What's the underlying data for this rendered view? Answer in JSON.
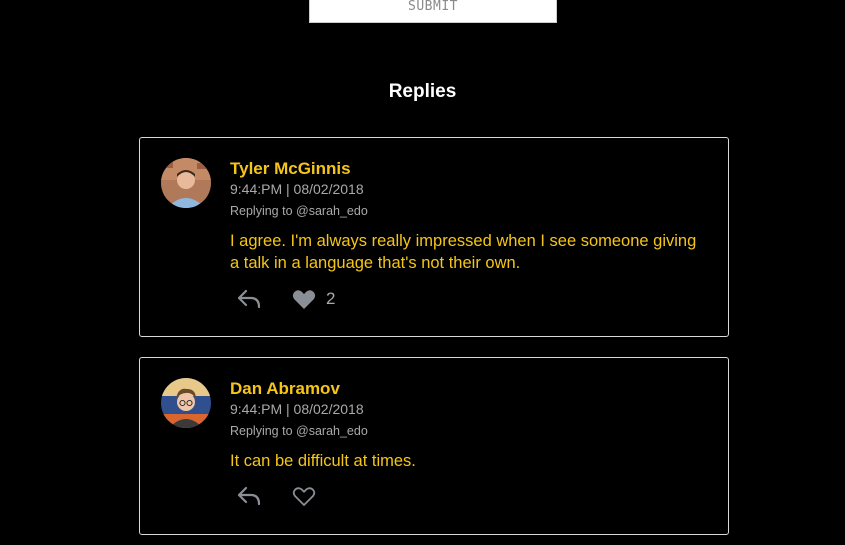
{
  "form": {
    "submit_label": "SUBMIT"
  },
  "replies_section": {
    "heading": "Replies"
  },
  "replies": [
    {
      "author": "Tyler McGinnis",
      "timestamp": "9:44:PM | 08/02/2018",
      "replying_to": "Replying to @sarah_edo",
      "text": "I agree. I'm always really impressed when I see someone giving a talk in a language that's not their own.",
      "likes": "2",
      "liked": true,
      "icons": [
        "reply-icon",
        "heart-filled-icon"
      ]
    },
    {
      "author": "Dan Abramov",
      "timestamp": "9:44:PM | 08/02/2018",
      "replying_to": "Replying to @sarah_edo",
      "text": "It can be difficult at times.",
      "likes": "",
      "liked": false,
      "icons": [
        "reply-icon",
        "heart-outline-icon"
      ]
    }
  ],
  "colors": {
    "background": "#000000",
    "accent": "#f5c518",
    "muted": "#a9a9a9",
    "card_border": "#d9d9d9"
  }
}
